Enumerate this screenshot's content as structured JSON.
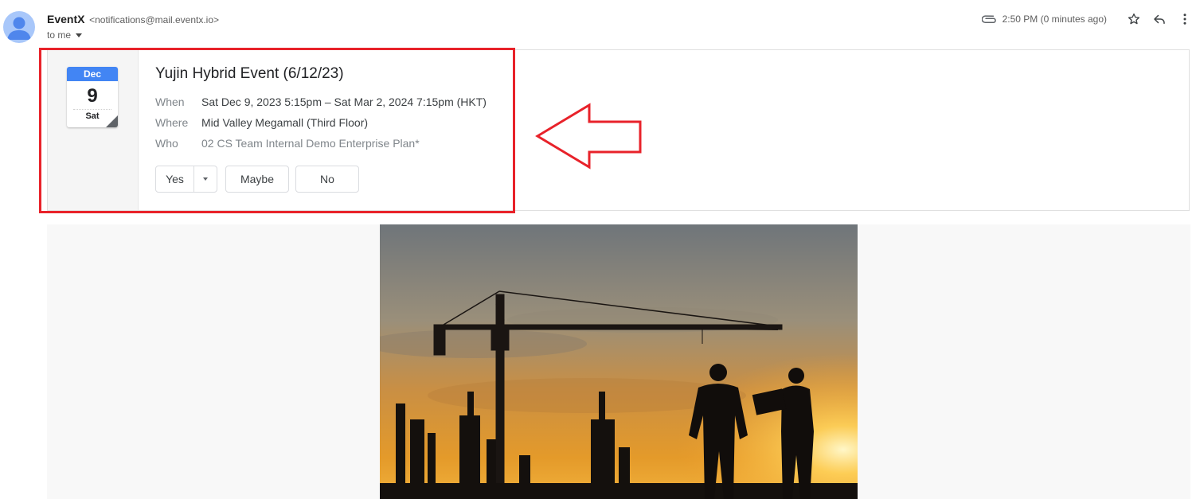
{
  "header": {
    "sender_name": "EventX",
    "sender_email": "<notifications@mail.eventx.io>",
    "to_label": "to me",
    "time": "2:50 PM (0 minutes ago)",
    "icons": [
      "attachment-icon",
      "star-icon",
      "reply-icon",
      "more-vert-icon"
    ]
  },
  "invite": {
    "calendar": {
      "month": "Dec",
      "day": "9",
      "weekday": "Sat"
    },
    "title": "Yujin Hybrid Event (6/12/23)",
    "when_label": "When",
    "when_value": "Sat Dec 9, 2023 5:15pm – Sat Mar 2, 2024 7:15pm (HKT)",
    "where_label": "Where",
    "where_value": "Mid Valley Megamall (Third Floor)",
    "who_label": "Who",
    "who_value": "02 CS Team Internal Demo Enterprise Plan*",
    "rsvp": {
      "yes": "Yes",
      "maybe": "Maybe",
      "no": "No"
    }
  },
  "annotation": {
    "color": "#e8222a"
  },
  "colors": {
    "accent": "#4285f4",
    "annotation": "#e8222a"
  }
}
